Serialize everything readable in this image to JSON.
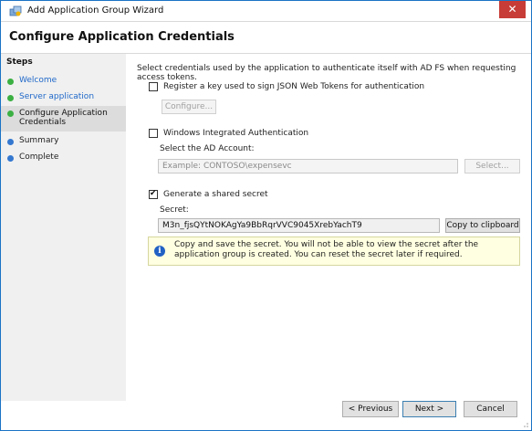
{
  "window": {
    "title": "Add Application Group Wizard",
    "close_label": "✕"
  },
  "page_title": "Configure Application Credentials",
  "steps": {
    "title": "Steps",
    "items": [
      {
        "label": "Welcome",
        "status": "complete"
      },
      {
        "label": "Server application",
        "status": "complete"
      },
      {
        "label": "Configure Application Credentials",
        "status": "current"
      },
      {
        "label": "Summary",
        "status": "pending"
      },
      {
        "label": "Complete",
        "status": "pending"
      }
    ]
  },
  "content": {
    "intro": "Select credentials used by the application to authenticate itself with AD FS when requesting access tokens.",
    "jwt": {
      "label": "Register a key used to sign JSON Web Tokens for authentication",
      "checked": false,
      "configure_label": "Configure..."
    },
    "wia": {
      "label": "Windows Integrated Authentication",
      "checked": false,
      "account_label": "Select the AD Account:",
      "account_placeholder": "Example: CONTOSO\\expensevc",
      "select_label": "Select..."
    },
    "shared_secret": {
      "label": "Generate a shared secret",
      "checked": true,
      "secret_label": "Secret:",
      "secret_value": "M3n_fjsQYtNOKAgYa9BbRqrVVC9045XrebYachT9",
      "copy_label": "Copy to clipboard",
      "info": "Copy and save the secret.  You will not be able to view the secret after the application group is created.  You can reset the secret later if required."
    }
  },
  "footer": {
    "previous_label": "< Previous",
    "next_label": "Next >",
    "cancel_label": "Cancel"
  },
  "colors": {
    "window_border": "#1a73c5",
    "close_button": "#c73c36",
    "link": "#1f68c9",
    "step_complete": "#3cb043",
    "step_pending": "#3478d0",
    "info_background": "#ffffe1"
  }
}
